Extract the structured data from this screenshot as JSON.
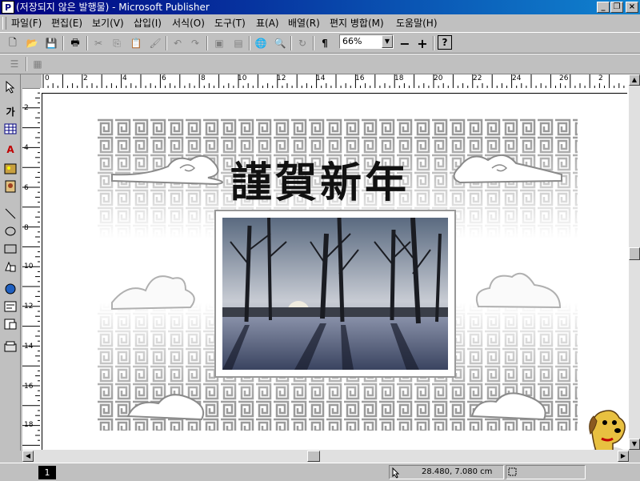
{
  "window": {
    "title": "(저장되지 않은 발행물) - Microsoft Publisher",
    "app_icon_glyph": "P"
  },
  "menu": [
    "파일(F)",
    "편집(E)",
    "보기(V)",
    "삽입(I)",
    "서식(O)",
    "도구(T)",
    "표(A)",
    "배열(R)",
    "편지 병합(M)",
    "도움말(H)"
  ],
  "toolbar": {
    "zoom_value": "66%"
  },
  "ruler": {
    "h_labels": [
      "0",
      "2",
      "4",
      "6",
      "8",
      "10",
      "12",
      "14",
      "16",
      "18",
      "20",
      "22",
      "24",
      "26",
      "2"
    ],
    "v_labels": [
      "2",
      "4",
      "6",
      "8",
      "10",
      "12",
      "14",
      "16",
      "18"
    ]
  },
  "objects_toolbar": {
    "text_tool_label": "가"
  },
  "card": {
    "headline": "謹賀新年"
  },
  "status": {
    "page_number": "1",
    "coordinates": "28.480, 7.080 cm"
  },
  "colors": {
    "title_bar": "#000080",
    "pattern_gray": "#9a9a9a"
  }
}
